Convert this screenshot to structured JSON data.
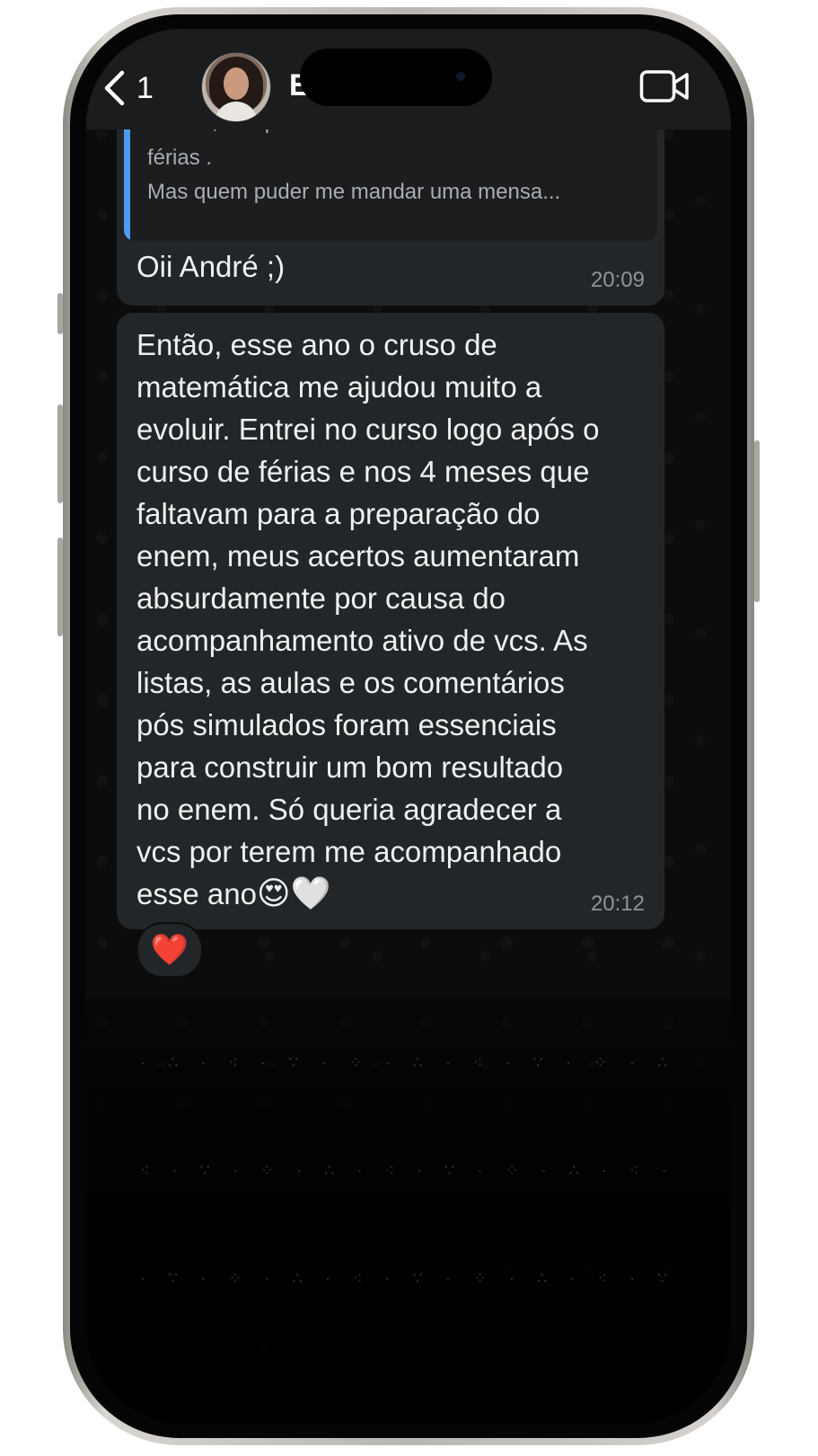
{
  "header": {
    "back_count": "1",
    "contact_name": "E          D"
  },
  "messages": [
    {
      "quote_lines": [
        "Galera, sei que tá todo mundo curtindo as",
        "férias .",
        "Mas quem puder me mandar uma mensa..."
      ],
      "text": "Oii André ;)",
      "time": "20:09"
    },
    {
      "lines": [
        "Então, esse ano o cruso de",
        "matemática me ajudou muito a",
        "evoluir. Entrei no curso logo após o",
        "curso de férias e nos 4 meses que",
        "faltavam para a preparação do",
        "enem, meus acertos aumentaram",
        "absurdamente por causa do",
        "acompanhamento ativo de vcs. As",
        "listas, as aulas e os comentários",
        "pós simulados foram essenciais",
        "para construir um bom resultado",
        "no enem. Só queria agradecer a",
        "vcs por terem me acompanhado"
      ],
      "last_line_text": "esse ano",
      "last_line_emojis": "😍🤍",
      "time": "20:12",
      "reaction": "❤️"
    }
  ],
  "icons": {
    "back": "chevron-left-icon",
    "video": "video-camera-icon"
  },
  "colors": {
    "bubble": "#232628",
    "quote_bar": "#4c9cf0",
    "header": "#1a1c1e"
  }
}
